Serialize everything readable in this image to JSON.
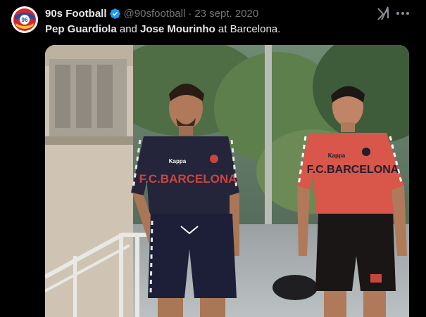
{
  "tweet": {
    "display_name": "90s Football",
    "handle": "@90sfootball",
    "separator": "·",
    "date": "23 sept. 2020",
    "text": {
      "name1": "Pep Guardiola",
      "and": " and ",
      "name2": "Jose Mourinho",
      "rest": " at Barcelona."
    }
  },
  "avatar": {
    "label": "96"
  },
  "photo": {
    "jersey_text_left": "F.C.BARCELONA",
    "jersey_text_right": "F.C.BARCELONA",
    "brand_logo": "Kappa"
  },
  "icons": {
    "verified": "verified-badge-icon",
    "grok": "grok-icon",
    "more": "more-options-icon"
  },
  "colors": {
    "background": "#000000",
    "text_primary": "#e7e9ea",
    "text_secondary": "#71767b",
    "verified_blue": "#1d9bf0"
  }
}
